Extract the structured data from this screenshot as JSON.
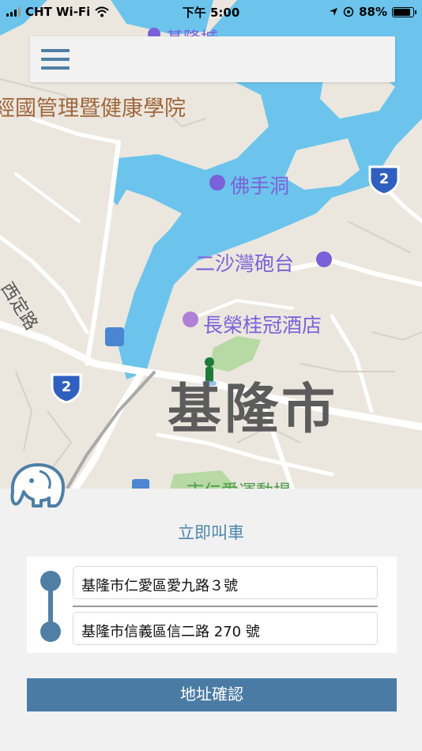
{
  "status_bar": {
    "carrier": "CHT Wi-Fi",
    "time": "下午 5:00",
    "battery_percent": "88%",
    "battery_level": 0.88
  },
  "header": {
    "menu_icon": "hamburger-menu-icon"
  },
  "map": {
    "labels": {
      "top_partial": "基隆城",
      "school": "經國管理暨健康學院",
      "cave": "佛手洞",
      "fort": "二沙灣砲台",
      "hotel": "長榮桂冠酒店",
      "city": "基隆市",
      "road": "西定路",
      "bottom_partial": "市仁愛運動場"
    },
    "route_shields": [
      "2",
      "2"
    ],
    "colors": {
      "water": "#6cc4ec",
      "land": "#ebe7df",
      "road": "#ffffff",
      "park": "#b7d9a4",
      "poi": "#7b61d8"
    }
  },
  "panel": {
    "title": "立即叫車",
    "pickup_address": "基隆市仁愛區愛九路３號",
    "dropoff_address": "基隆市信義區信二路 270 號",
    "confirm_label": "地址確認",
    "accent_color": "#4a7ba4"
  }
}
